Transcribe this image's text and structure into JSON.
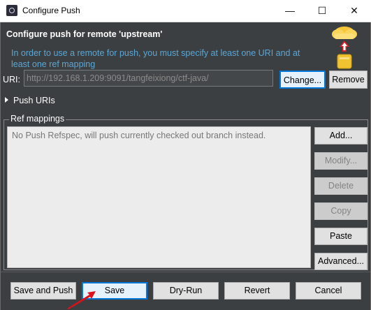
{
  "window": {
    "title": "Configure Push",
    "minimize_glyph": "—",
    "maximize_glyph": "☐",
    "close_glyph": "✕"
  },
  "header": {
    "heading": "Configure push for remote 'upstream'",
    "description": "In order to use a remote for push, you must specify at least one URI and at least one ref mapping",
    "icon": "cloud-push-icon"
  },
  "uri": {
    "label": "URI:",
    "value": "http://192.168.1.209:9091/tangfeixiong/ctf-java/",
    "change_label": "Change...",
    "remove_label": "Remove"
  },
  "push_uris": {
    "label": "Push URIs",
    "expanded": false
  },
  "ref_mappings": {
    "label": "Ref mappings",
    "empty_message": "No Push Refspec, will push currently checked out branch instead.",
    "buttons": {
      "add": "Add...",
      "modify": "Modify...",
      "delete": "Delete",
      "copy": "Copy",
      "paste": "Paste",
      "advanced": "Advanced..."
    }
  },
  "footer": {
    "save_and_push": "Save and Push",
    "save": "Save",
    "dry_run": "Dry-Run",
    "revert": "Revert",
    "cancel": "Cancel"
  },
  "colors": {
    "dialog_bg": "#3c3f41",
    "description_text": "#5aa7d6",
    "focus_border": "#0078d7",
    "pointer_arrow": "#e0101a"
  }
}
